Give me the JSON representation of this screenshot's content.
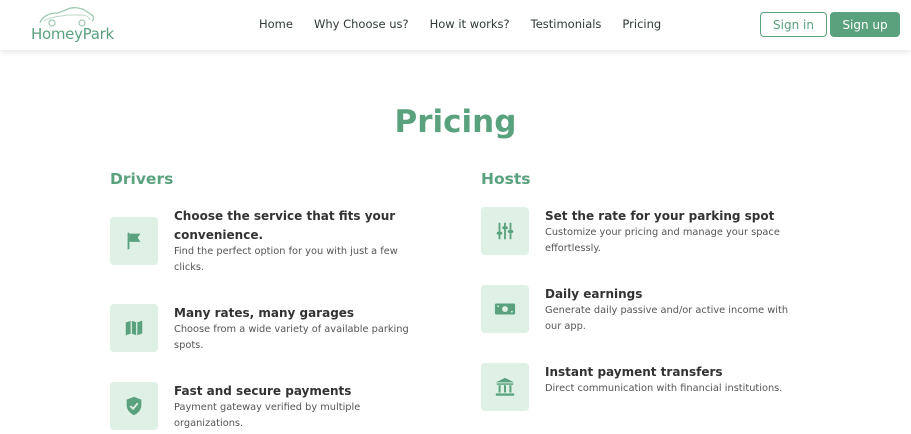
{
  "header": {
    "logo_text": "HomeyPark",
    "nav": [
      "Home",
      "Why Choose us?",
      "How it works?",
      "Testimonials",
      "Pricing"
    ],
    "signin_label": "Sign in",
    "signup_label": "Sign up"
  },
  "page": {
    "title": "Pricing"
  },
  "drivers": {
    "heading": "Drivers",
    "items": [
      {
        "icon": "flag-icon",
        "title": "Choose the service that fits your convenience.",
        "desc": "Find the perfect option for you with just a few clicks."
      },
      {
        "icon": "map-icon",
        "title": "Many rates, many garages",
        "desc": "Choose from a wide variety of available parking spots."
      },
      {
        "icon": "shield-check-icon",
        "title": "Fast and secure payments",
        "desc": "Payment gateway verified by multiple organizations."
      }
    ]
  },
  "hosts": {
    "heading": "Hosts",
    "items": [
      {
        "icon": "sliders-icon",
        "title": "Set the rate for your parking spot",
        "desc": "Customize your pricing and manage your space effortlessly."
      },
      {
        "icon": "money-icon",
        "title": "Daily earnings",
        "desc": "Generate daily passive and/or active income with our app."
      },
      {
        "icon": "bank-icon",
        "title": "Instant payment transfers",
        "desc": "Direct communication with financial institutions."
      }
    ]
  },
  "colors": {
    "accent": "#5aa27d",
    "icon_bg": "#dff0e5",
    "text": "#333333"
  }
}
